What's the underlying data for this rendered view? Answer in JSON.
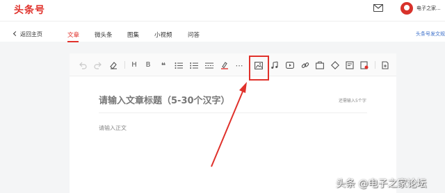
{
  "header": {
    "logo": "头条号",
    "username": "电子之家..."
  },
  "nav": {
    "back_label": "返回主页",
    "tabs": [
      {
        "label": "文章",
        "active": true
      },
      {
        "label": "微头条",
        "active": false
      },
      {
        "label": "图集",
        "active": false
      },
      {
        "label": "小视频",
        "active": false
      },
      {
        "label": "问答",
        "active": false
      }
    ],
    "right_link": "头条号发文规"
  },
  "toolbar": {
    "buttons": [
      "undo-icon",
      "redo-icon",
      "eraser-icon",
      "heading-icon",
      "bold-icon",
      "quote-icon",
      "unordered-list-icon",
      "ordered-list-icon",
      "divider-icon",
      "highlight-icon",
      "more-icon",
      "image-icon",
      "music-icon",
      "video-icon",
      "link-icon",
      "poll-icon",
      "vote-icon",
      "document-icon",
      "card-icon",
      "draft-icon"
    ],
    "heading_text": "H",
    "bold_text": "B",
    "quote_text": "❝",
    "more_text": "⋯"
  },
  "editor": {
    "title_placeholder": "请输入文章标题（5-30个汉字）",
    "title_hint": "还需输入5个字",
    "body_placeholder": "请输入正文"
  },
  "watermark": "头条 @电子之家论坛",
  "colors": {
    "accent": "#e0312b",
    "link": "#3a6ec9"
  }
}
